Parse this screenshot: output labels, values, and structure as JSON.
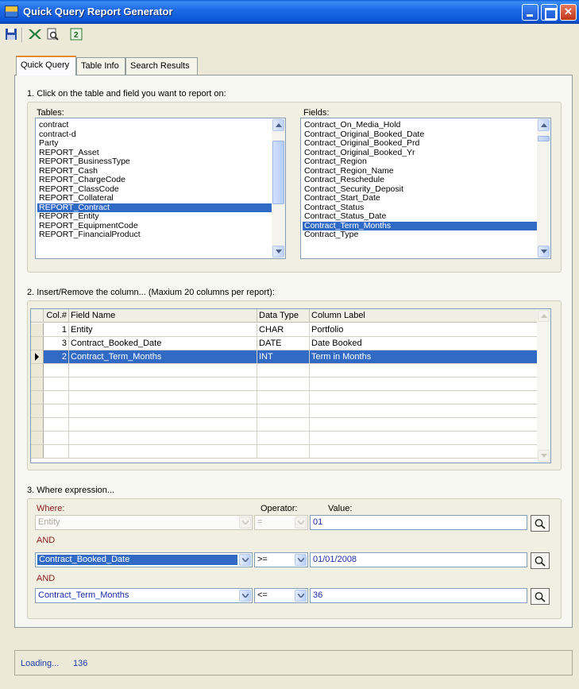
{
  "window": {
    "title": "Quick Query Report Generator"
  },
  "toolbar": {
    "icons": [
      "save-icon",
      "excel-export-icon",
      "print-preview-icon",
      "refresh-icon"
    ]
  },
  "tabs": [
    {
      "label": "Quick Query",
      "active": true
    },
    {
      "label": "Table Info",
      "active": false
    },
    {
      "label": "Search Results",
      "active": false
    }
  ],
  "step1": {
    "instruction": "1. Click on the table and field you want to report on:",
    "tables_label": "Tables:",
    "fields_label": "Fields:",
    "tables": [
      "contract",
      "contract-d",
      "Party",
      "REPORT_Asset",
      "REPORT_BusinessType",
      "REPORT_Cash",
      "REPORT_ChargeCode",
      "REPORT_ClassCode",
      "REPORT_Collateral",
      "REPORT_Contract",
      "REPORT_Entity",
      "REPORT_EquipmentCode",
      "REPORT_FinancialProduct"
    ],
    "selected_table": "REPORT_Contract",
    "fields": [
      "Contract_On_Media_Hold",
      "Contract_Original_Booked_Date",
      "Contract_Original_Booked_Prd",
      "Contract_Original_Booked_Yr",
      "Contract_Region",
      "Contract_Region_Name",
      "Contract_Reschedule",
      "Contract_Security_Deposit",
      "Contract_Start_Date",
      "Contract_Status",
      "Contract_Status_Date",
      "Contract_Term_Months",
      "Contract_Type"
    ],
    "selected_field": "Contract_Term_Months"
  },
  "step2": {
    "instruction": "2. Insert/Remove the column... (Maxium 20 columns per report):",
    "columns": [
      "Col.#",
      "Field Name",
      "Data Type",
      "Column Label"
    ],
    "rows": [
      {
        "col": "1",
        "field": "Entity",
        "type": "CHAR",
        "label": "Portfolio",
        "selected": false
      },
      {
        "col": "3",
        "field": "Contract_Booked_Date",
        "type": "DATE",
        "label": "Date Booked",
        "selected": false
      },
      {
        "col": "2",
        "field": "Contract_Term_Months",
        "type": "INT",
        "label": "Term in Months",
        "selected": true
      }
    ]
  },
  "step3": {
    "instruction": "3. Where expression...",
    "where_label": "Where:",
    "operator_label": "Operator:",
    "value_label": "Value:",
    "conditions": [
      {
        "connector": "",
        "field": "Entity",
        "operator": "=",
        "value": "01"
      },
      {
        "connector": "AND",
        "field": "Contract_Booked_Date",
        "operator": ">=",
        "value": "01/01/2008"
      },
      {
        "connector": "AND",
        "field": "Contract_Term_Months",
        "operator": "<=",
        "value": "36"
      }
    ]
  },
  "status": {
    "text": "Loading...",
    "count": "136"
  },
  "colors": {
    "selection": "#316ac5",
    "title_bar": "#1e6ae6",
    "where_label": "#8b1a1a",
    "value_text": "#1a2aa8"
  }
}
